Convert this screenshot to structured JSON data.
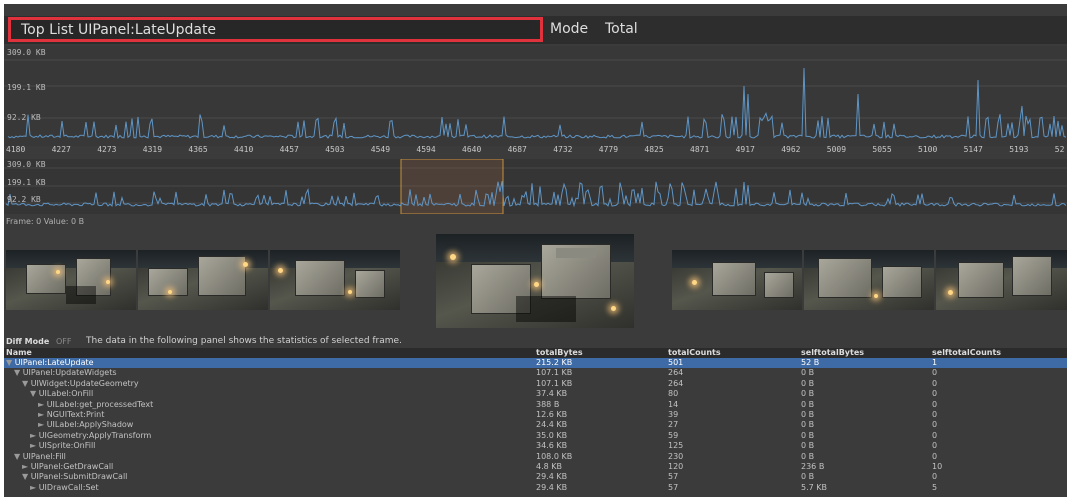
{
  "topbar": {
    "top_list": "Top List  UIPanel:LateUpdate",
    "mode": "Mode",
    "total": "Total"
  },
  "main_graph": {
    "y_labels": [
      "309.0 KB",
      "199.1 KB",
      "92.2 KB"
    ],
    "x_ticks": [
      "4180",
      "4227",
      "4273",
      "4319",
      "4365",
      "4410",
      "4457",
      "4503",
      "4549",
      "4594",
      "4640",
      "4687",
      "4732",
      "4779",
      "4825",
      "4871",
      "4917",
      "4962",
      "5009",
      "5055",
      "5100",
      "5147",
      "5193",
      "52"
    ]
  },
  "overview_graph": {
    "y_labels": [
      "309.0 KB",
      "199.1 KB",
      "92.2 KB"
    ]
  },
  "frame_info": "Frame: 0   Value: 0 B",
  "diff": {
    "label": "Diff Mode",
    "toggle": "OFF",
    "description": "The data in the following panel shows the statistics of selected frame."
  },
  "table": {
    "headers": [
      "Name",
      "totalBytes",
      "totalCounts",
      "selftotalBytes",
      "selftotalCounts"
    ],
    "rows": [
      {
        "tri": "▼",
        "name": "UIPanel:LateUpdate",
        "bytes": "215.2 KB",
        "counts": "501",
        "self_bytes": "52 B",
        "self_counts": "1"
      },
      {
        "tri": "▼",
        "name": "UIPanel:UpdateWidgets",
        "bytes": "107.1 KB",
        "counts": "264",
        "self_bytes": "0 B",
        "self_counts": "0"
      },
      {
        "tri": "▼",
        "name": "UIWidget:UpdateGeometry",
        "bytes": "107.1 KB",
        "counts": "264",
        "self_bytes": "0 B",
        "self_counts": "0"
      },
      {
        "tri": "▼",
        "name": "UILabel:OnFill",
        "bytes": "37.4 KB",
        "counts": "80",
        "self_bytes": "0 B",
        "self_counts": "0"
      },
      {
        "tri": "►",
        "name": "UILabel:get_processedText",
        "bytes": "388 B",
        "counts": "14",
        "self_bytes": "0 B",
        "self_counts": "0"
      },
      {
        "tri": "►",
        "name": "NGUIText:Print",
        "bytes": "12.6 KB",
        "counts": "39",
        "self_bytes": "0 B",
        "self_counts": "0"
      },
      {
        "tri": "►",
        "name": "UILabel:ApplyShadow",
        "bytes": "24.4 KB",
        "counts": "27",
        "self_bytes": "0 B",
        "self_counts": "0"
      },
      {
        "tri": "►",
        "name": "UIGeometry:ApplyTransform",
        "bytes": "35.0 KB",
        "counts": "59",
        "self_bytes": "0 B",
        "self_counts": "0"
      },
      {
        "tri": "►",
        "name": "UISprite:OnFill",
        "bytes": "34.6 KB",
        "counts": "125",
        "self_bytes": "0 B",
        "self_counts": "0"
      },
      {
        "tri": "▼",
        "name": "UIPanel:Fill",
        "bytes": "108.0 KB",
        "counts": "230",
        "self_bytes": "0 B",
        "self_counts": "0"
      },
      {
        "tri": "►",
        "name": "UIPanel:GetDrawCall",
        "bytes": "4.8 KB",
        "counts": "120",
        "self_bytes": "236 B",
        "self_counts": "10"
      },
      {
        "tri": "▼",
        "name": "UIPanel:SubmitDrawCall",
        "bytes": "29.4 KB",
        "counts": "57",
        "self_bytes": "0 B",
        "self_counts": "0"
      },
      {
        "tri": "►",
        "name": "UIDrawCall:Set",
        "bytes": "29.4 KB",
        "counts": "57",
        "self_bytes": "5.7 KB",
        "self_counts": "5"
      }
    ]
  },
  "colors": {
    "accent": "#e0323c",
    "selection": "#3e6ba6",
    "graph_line": "#5f95c5",
    "range_highlight": "#c8913a"
  }
}
